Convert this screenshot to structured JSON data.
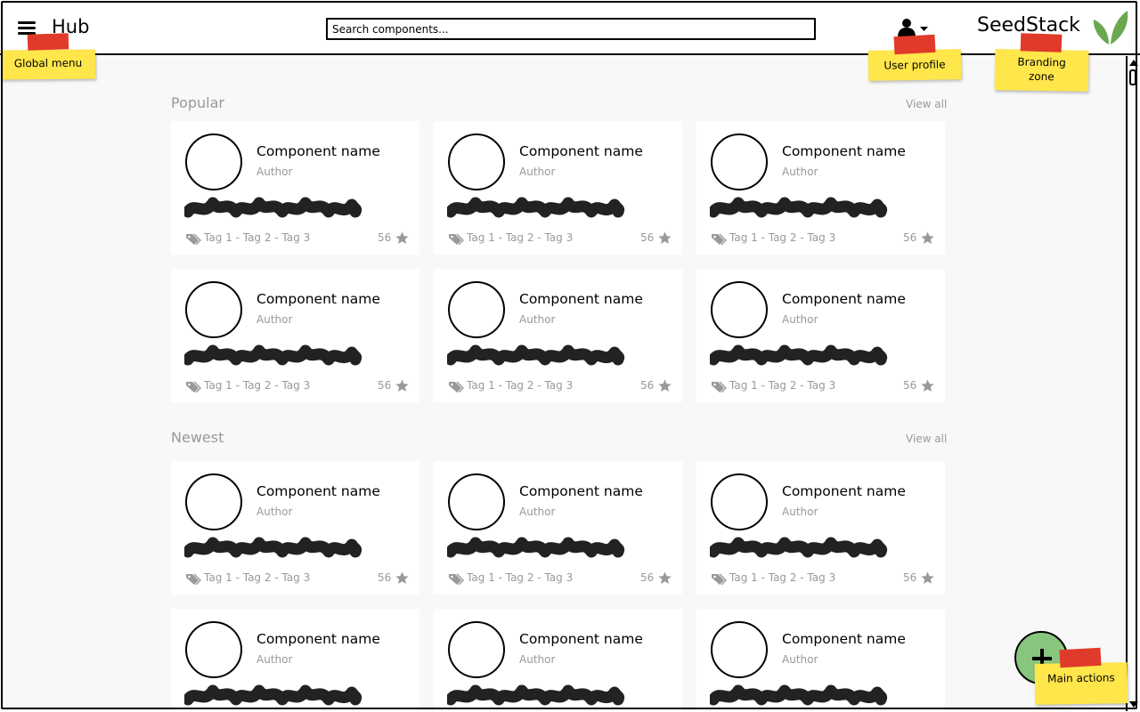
{
  "header": {
    "app_title": "Hub",
    "search_placeholder": "Search components...",
    "brand_name": "SeedStack"
  },
  "sections": [
    {
      "title": "Popular",
      "view_all": "View all",
      "cards": [
        {
          "name": "Component name",
          "author": "Author",
          "tags": "Tag 1 - Tag 2 - Tag 3",
          "stars": "56"
        },
        {
          "name": "Component name",
          "author": "Author",
          "tags": "Tag 1 - Tag 2 - Tag 3",
          "stars": "56"
        },
        {
          "name": "Component name",
          "author": "Author",
          "tags": "Tag 1 - Tag 2 - Tag 3",
          "stars": "56"
        },
        {
          "name": "Component name",
          "author": "Author",
          "tags": "Tag 1 - Tag 2 - Tag 3",
          "stars": "56"
        },
        {
          "name": "Component name",
          "author": "Author",
          "tags": "Tag 1 - Tag 2 - Tag 3",
          "stars": "56"
        },
        {
          "name": "Component name",
          "author": "Author",
          "tags": "Tag 1 - Tag 2 - Tag 3",
          "stars": "56"
        }
      ]
    },
    {
      "title": "Newest",
      "view_all": "View all",
      "cards": [
        {
          "name": "Component name",
          "author": "Author",
          "tags": "Tag 1 - Tag 2 - Tag 3",
          "stars": "56"
        },
        {
          "name": "Component name",
          "author": "Author",
          "tags": "Tag 1 - Tag 2 - Tag 3",
          "stars": "56"
        },
        {
          "name": "Component name",
          "author": "Author",
          "tags": "Tag 1 - Tag 2 - Tag 3",
          "stars": "56"
        },
        {
          "name": "Component name",
          "author": "Author"
        },
        {
          "name": "Component name",
          "author": "Author"
        },
        {
          "name": "Component name",
          "author": "Author"
        }
      ]
    }
  ],
  "annotations": {
    "global_menu": "Global menu",
    "user_profile": "User profile",
    "branding_line1": "Branding",
    "branding_line2": "zone",
    "main_actions": "Main actions"
  },
  "colors": {
    "fab_green": "#88c57e",
    "sticky_yellow": "#ffe64b",
    "tape_red": "#e03a2a",
    "muted_text": "#999999",
    "leaf_green": "#6aa84f"
  },
  "icons": [
    "menu-icon",
    "user-icon",
    "chevron-down-icon",
    "leaf-logo-icon",
    "tag-icon",
    "star-icon",
    "plus-icon"
  ]
}
